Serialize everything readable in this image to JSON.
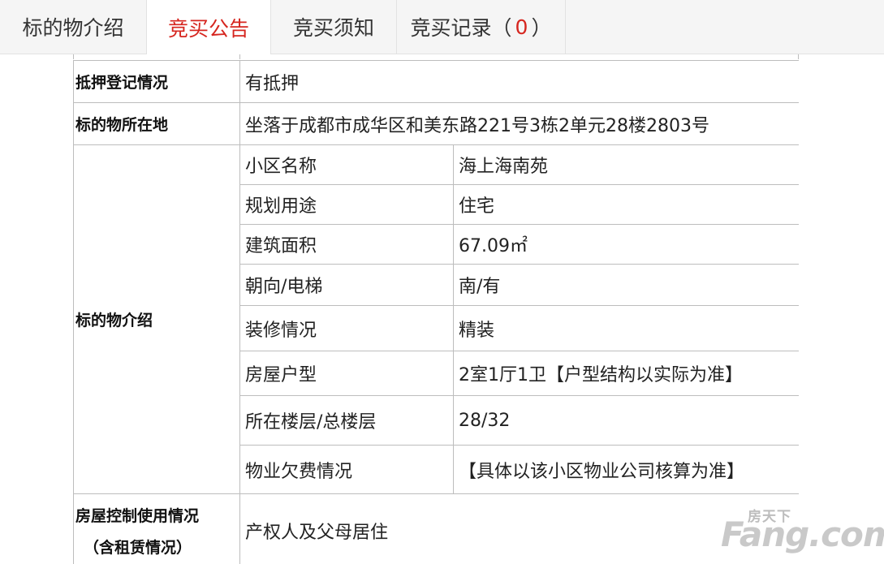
{
  "tabs": [
    {
      "label": "标的物介绍"
    },
    {
      "label": "竞买公告"
    },
    {
      "label": "竞买须知"
    },
    {
      "label": "竞买记录（",
      "count": "0",
      "close": "）"
    }
  ],
  "table": {
    "mortgage_label": "抵押登记情况",
    "mortgage_value": "有抵押",
    "location_label": "标的物所在地",
    "location_value": "坐落于成都市成华区和美东路221号3栋2单元28楼2803号",
    "intro_label": "标的物介绍",
    "intro_rows": [
      {
        "key": "小区名称",
        "value": "海上海南苑"
      },
      {
        "key": "规划用途",
        "value": "住宅"
      },
      {
        "key": "建筑面积",
        "value": "67.09㎡"
      },
      {
        "key": "朝向/电梯",
        "value": "南/有"
      },
      {
        "key": "装修情况",
        "value": "精装"
      },
      {
        "key": "房屋户型",
        "value": "2室1厅1卫【户型结构以实际为准】"
      },
      {
        "key": "所在楼层/总楼层",
        "value": "28/32"
      },
      {
        "key": "物业欠费情况",
        "value": "【具体以该小区物业公司核算为准】"
      }
    ],
    "control_label_line1": "房屋控制使用情况",
    "control_label_line2": "（含租赁情况）",
    "control_value": "产权人及父母居住"
  },
  "watermark": {
    "cn": "房天下",
    "en": "Fang.com"
  }
}
